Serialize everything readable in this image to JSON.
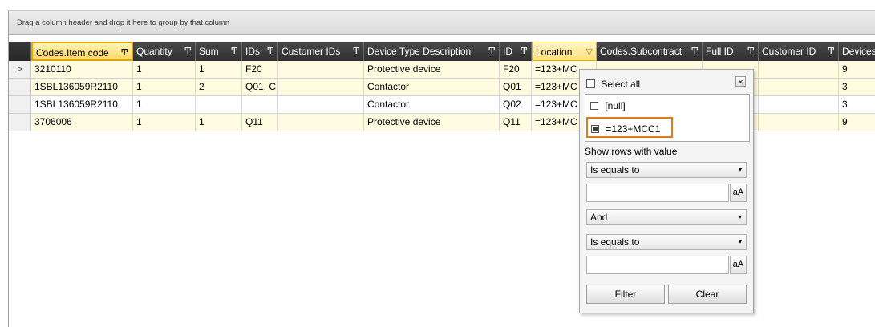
{
  "group_panel": {
    "hint": "Drag a column header and drop it here to group by that column"
  },
  "headers": [
    {
      "label": "Codes.Item code",
      "filter": "Ͳ"
    },
    {
      "label": "Quantity",
      "filter": "Ͳ"
    },
    {
      "label": "Sum",
      "filter": "Ͳ"
    },
    {
      "label": "IDs",
      "filter": "Ͳ"
    },
    {
      "label": "Customer IDs",
      "filter": "Ͳ"
    },
    {
      "label": "Device Type Description",
      "filter": "Ͳ"
    },
    {
      "label": "ID",
      "filter": "Ͳ"
    },
    {
      "label": "Location",
      "filter": "▽"
    },
    {
      "label": "Codes.Subcontract",
      "filter": "Ͳ"
    },
    {
      "label": "Full ID",
      "filter": "Ͳ"
    },
    {
      "label": "Customer ID",
      "filter": "Ͳ"
    },
    {
      "label": "Devices",
      "filter": ""
    }
  ],
  "rows": [
    {
      "item_code": "3210110",
      "quantity": "1",
      "sum": "1",
      "ids": "F20",
      "customer_ids": "",
      "device_type": "Protective device",
      "id": "F20",
      "location": "=123+MC",
      "devices": "9"
    },
    {
      "item_code": "1SBL136059R2110",
      "quantity": "1",
      "sum": "2",
      "ids": "Q01, C",
      "customer_ids": "",
      "device_type": "Contactor",
      "id": "Q01",
      "location": "=123+MC",
      "devices": "3"
    },
    {
      "item_code": "1SBL136059R2110",
      "quantity": "1",
      "sum": "",
      "ids": "",
      "customer_ids": "",
      "device_type": "Contactor",
      "id": "Q02",
      "location": "=123+MC",
      "devices": "3"
    },
    {
      "item_code": "3706006",
      "quantity": "1",
      "sum": "1",
      "ids": "Q11",
      "customer_ids": "",
      "device_type": "Protective device",
      "id": "Q11",
      "location": "=123+MC",
      "devices": "9"
    }
  ],
  "row_indicator": ">",
  "filter_popup": {
    "select_all": "Select all",
    "close": "✕",
    "values": [
      {
        "label": "[null]",
        "checked": false
      },
      {
        "label": "=123+MCC1",
        "checked": true
      }
    ],
    "show_rows_label": "Show rows with value",
    "operator1": "Is equals to",
    "logic": "And",
    "operator2": "Is equals to",
    "match_case": "aA",
    "filter_button": "Filter",
    "clear_button": "Clear"
  },
  "colors": {
    "header_bg": "#3a3a3a",
    "active_header": "#ffd866",
    "alt_row": "#fffbe0",
    "highlight_border": "#e07b1a"
  }
}
